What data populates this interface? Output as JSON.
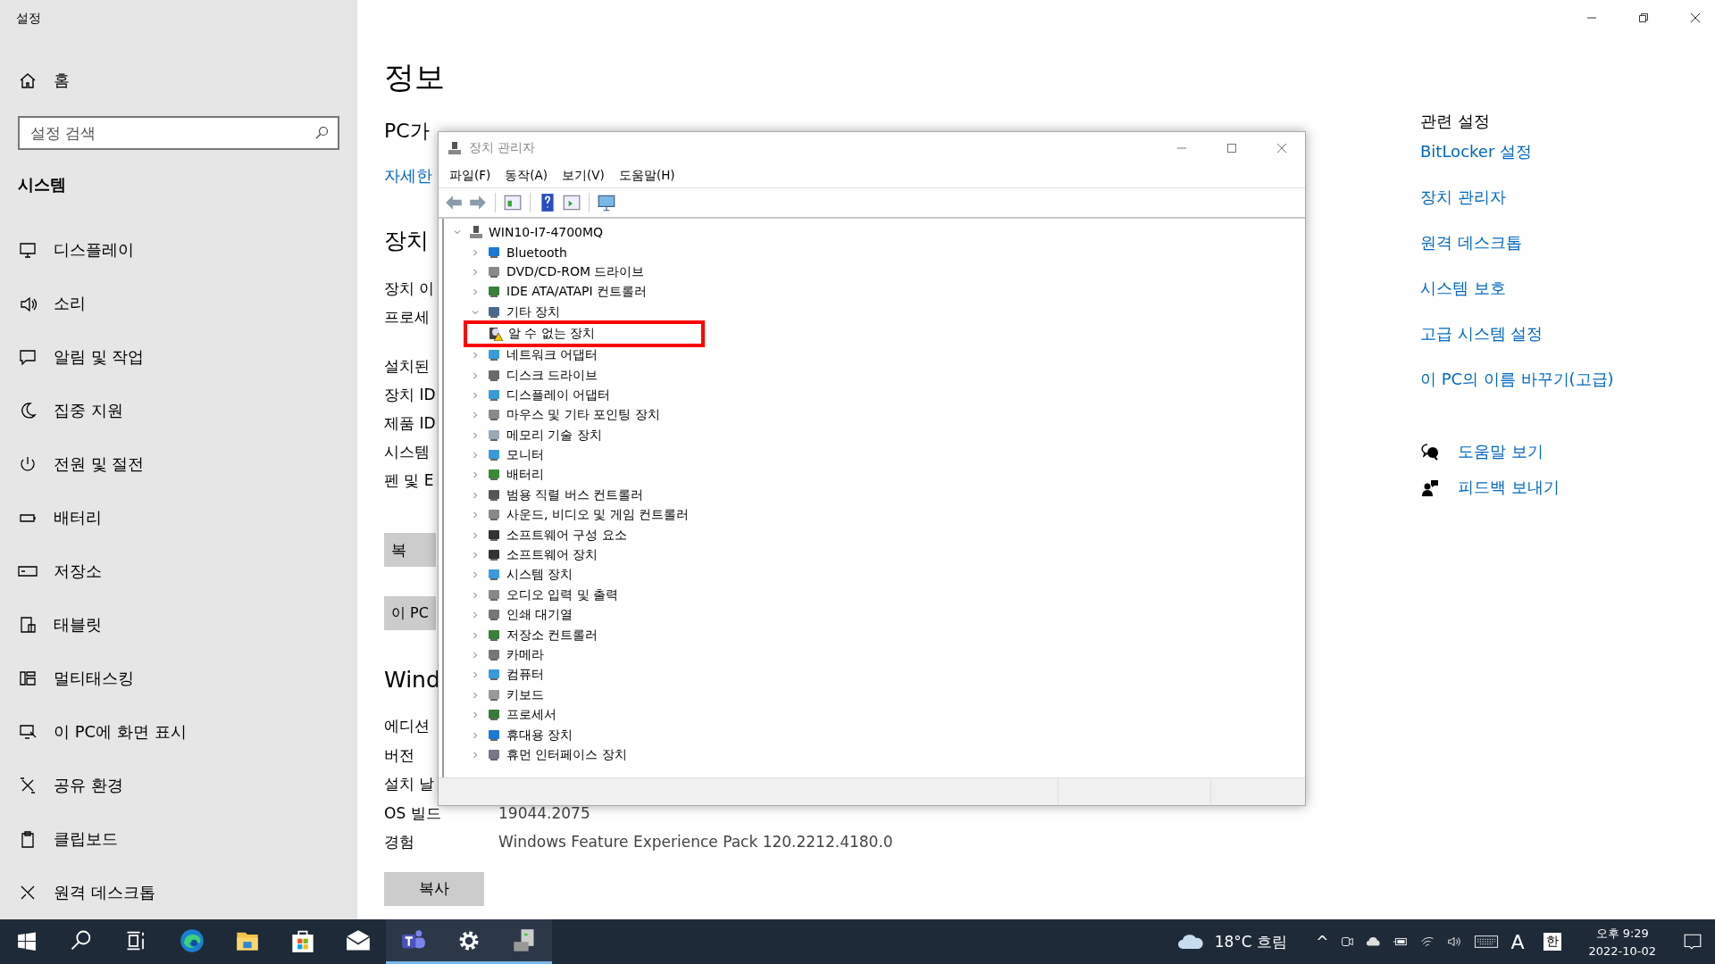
{
  "settings": {
    "title": "설정",
    "home": "홈",
    "search": {
      "placeholder": "설정 검색"
    },
    "section": "시스템",
    "nav": [
      {
        "label": "디스플레이",
        "selected": false
      },
      {
        "label": "소리",
        "selected": false
      },
      {
        "label": "알림 및 작업",
        "selected": false
      },
      {
        "label": "집중 지원",
        "selected": false
      },
      {
        "label": "전원 및 절전",
        "selected": false
      },
      {
        "label": "배터리",
        "selected": false
      },
      {
        "label": "저장소",
        "selected": false
      },
      {
        "label": "태블릿",
        "selected": false
      },
      {
        "label": "멀티태스킹",
        "selected": false
      },
      {
        "label": "이 PC에 화면 표시",
        "selected": false
      },
      {
        "label": "공유 환경",
        "selected": false
      },
      {
        "label": "클립보드",
        "selected": false
      },
      {
        "label": "원격 데스크톱",
        "selected": false
      }
    ],
    "page_title": "정보",
    "protected_heading": "PC가",
    "more_link": "자세한",
    "device_heading": "장치",
    "device_specs": [
      "장치 이",
      "프로세"
    ],
    "device_specs_2": [
      "설치된",
      "장치 ID",
      "제품 ID",
      "시스템",
      "펜 및 E"
    ],
    "copy_button_cut": "복",
    "rename_button_cut": "이 PC",
    "windows_heading": "Wind",
    "windows_specs": [
      {
        "label": "에디션"
      },
      {
        "label": "버전"
      },
      {
        "label": "설치 날"
      },
      {
        "label": "OS 빌드",
        "value": "19044.2075"
      },
      {
        "label": "경험",
        "value": "Windows Feature Experience Pack 120.2212.4180.0"
      }
    ],
    "copy_button": "복사",
    "related": {
      "title": "관련 설정",
      "links": [
        "BitLocker 설정",
        "장치 관리자",
        "원격 데스크톱",
        "시스템 보호",
        "고급 시스템 설정",
        "이 PC의 이름 바꾸기(고급)"
      ]
    },
    "help": [
      "도움말 보기",
      "피드백 보내기"
    ]
  },
  "device_manager": {
    "title": "장치 관리자",
    "menu": [
      "파일(F)",
      "동작(A)",
      "보기(V)",
      "도움말(H)"
    ],
    "tree": {
      "label": "WIN10-I7-4700MQ",
      "expanded": true,
      "children": [
        {
          "label": "Bluetooth",
          "expanded": false
        },
        {
          "label": "DVD/CD-ROM 드라이브",
          "expanded": false
        },
        {
          "label": "IDE ATA/ATAPI 컨트롤러",
          "expanded": false
        },
        {
          "label": "기타 장치",
          "expanded": true,
          "children": [
            {
              "label": "알 수 없는 장치",
              "highlighted": true,
              "warning": true
            }
          ]
        },
        {
          "label": "네트워크 어댑터",
          "expanded": false
        },
        {
          "label": "디스크 드라이브",
          "expanded": false
        },
        {
          "label": "디스플레이 어댑터",
          "expanded": false
        },
        {
          "label": "마우스 및 기타 포인팅 장치",
          "expanded": false
        },
        {
          "label": "메모리 기술 장치",
          "expanded": false
        },
        {
          "label": "모니터",
          "expanded": false
        },
        {
          "label": "배터리",
          "expanded": false
        },
        {
          "label": "범용 직렬 버스 컨트롤러",
          "expanded": false
        },
        {
          "label": "사운드, 비디오 및 게임 컨트롤러",
          "expanded": false
        },
        {
          "label": "소프트웨어 구성 요소",
          "expanded": false
        },
        {
          "label": "소프트웨어 장치",
          "expanded": false
        },
        {
          "label": "시스템 장치",
          "expanded": false
        },
        {
          "label": "오디오 입력 및 출력",
          "expanded": false
        },
        {
          "label": "인쇄 대기열",
          "expanded": false
        },
        {
          "label": "저장소 컨트롤러",
          "expanded": false
        },
        {
          "label": "카메라",
          "expanded": false
        },
        {
          "label": "컴퓨터",
          "expanded": false
        },
        {
          "label": "키보드",
          "expanded": false
        },
        {
          "label": "프로세서",
          "expanded": false
        },
        {
          "label": "휴대용 장치",
          "expanded": false
        },
        {
          "label": "휴먼 인터페이스 장치",
          "expanded": false
        }
      ]
    }
  },
  "taskbar": {
    "apps": [
      {
        "kind": "search",
        "running": false
      },
      {
        "kind": "taskview",
        "running": false
      },
      {
        "kind": "browser",
        "running": false
      },
      {
        "kind": "folder",
        "running": false
      },
      {
        "kind": "store",
        "running": false
      },
      {
        "kind": "mail",
        "running": false
      },
      {
        "kind": "chat",
        "running": true
      },
      {
        "kind": "settings",
        "running": true
      },
      {
        "kind": "devmgr",
        "running": true
      }
    ],
    "weather": "18°C 흐림",
    "chevron": "^",
    "ime_mode": "A",
    "ime_lang": "한",
    "time": "오후 9:29",
    "date": "2022-10-02"
  }
}
